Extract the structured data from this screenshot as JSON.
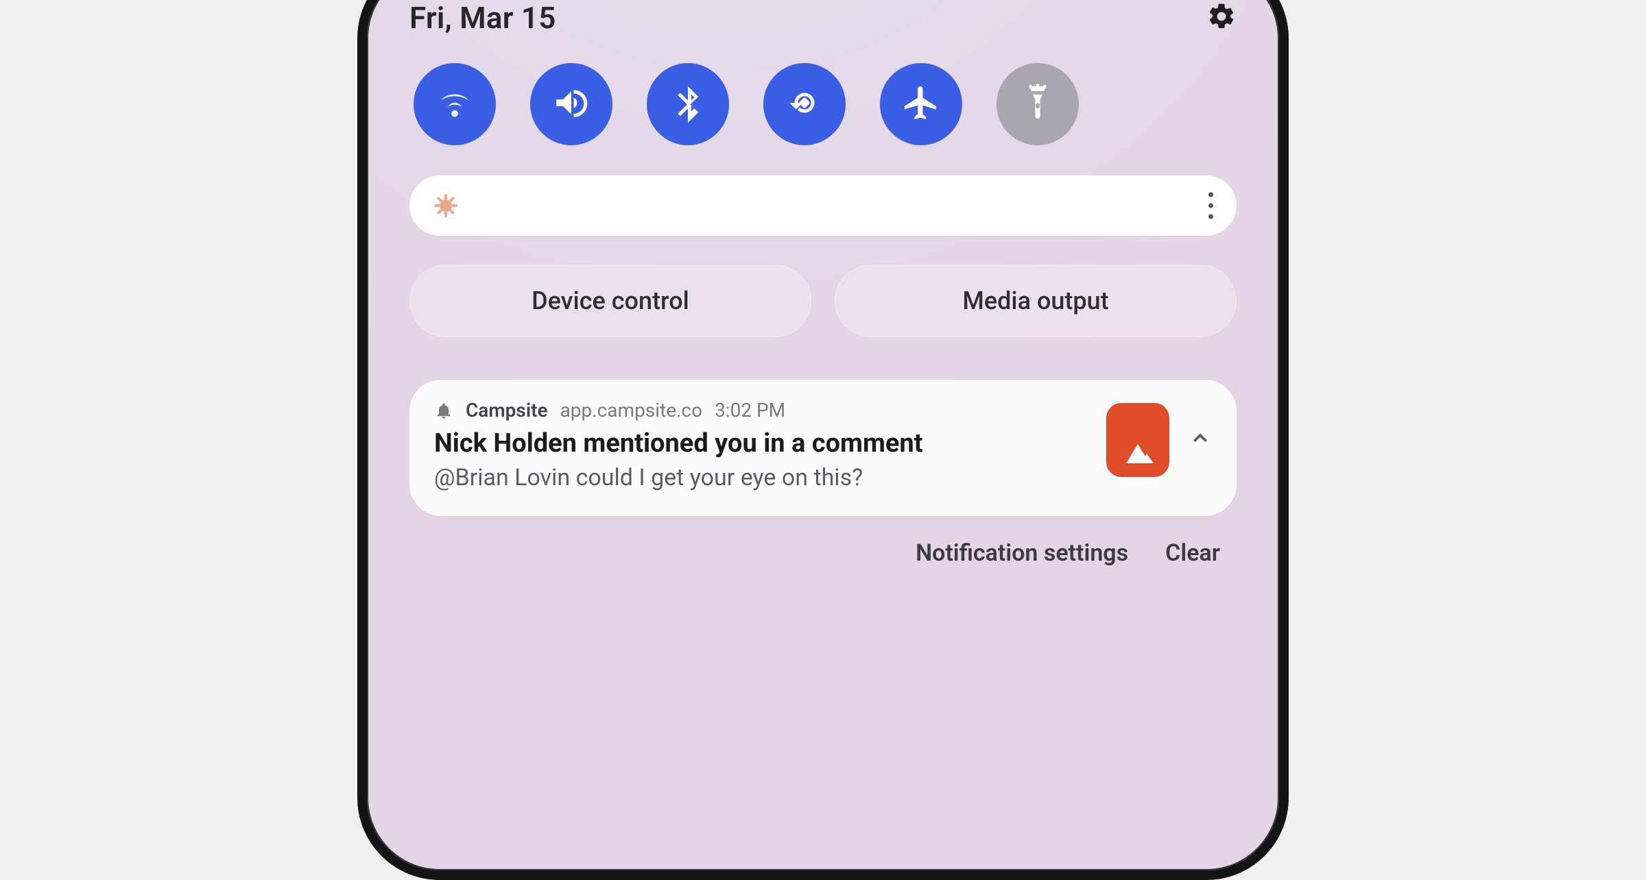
{
  "header": {
    "date": "Fri, Mar 15"
  },
  "quick_tiles": [
    {
      "name": "wifi",
      "state": "on"
    },
    {
      "name": "sound",
      "state": "on"
    },
    {
      "name": "bluetooth",
      "state": "on"
    },
    {
      "name": "autorotate",
      "state": "on"
    },
    {
      "name": "airplane",
      "state": "on"
    },
    {
      "name": "flashlight",
      "state": "off"
    }
  ],
  "pills": {
    "device_control": "Device control",
    "media_output": "Media output"
  },
  "notification": {
    "app_name": "Campsite",
    "domain": "app.campsite.co",
    "time": "3:02 PM",
    "title": "Nick Holden mentioned you in a comment",
    "body": "@Brian Lovin could I get your eye on this?",
    "brand_color": "#E04D2B"
  },
  "footer": {
    "settings": "Notification settings",
    "clear": "Clear"
  }
}
